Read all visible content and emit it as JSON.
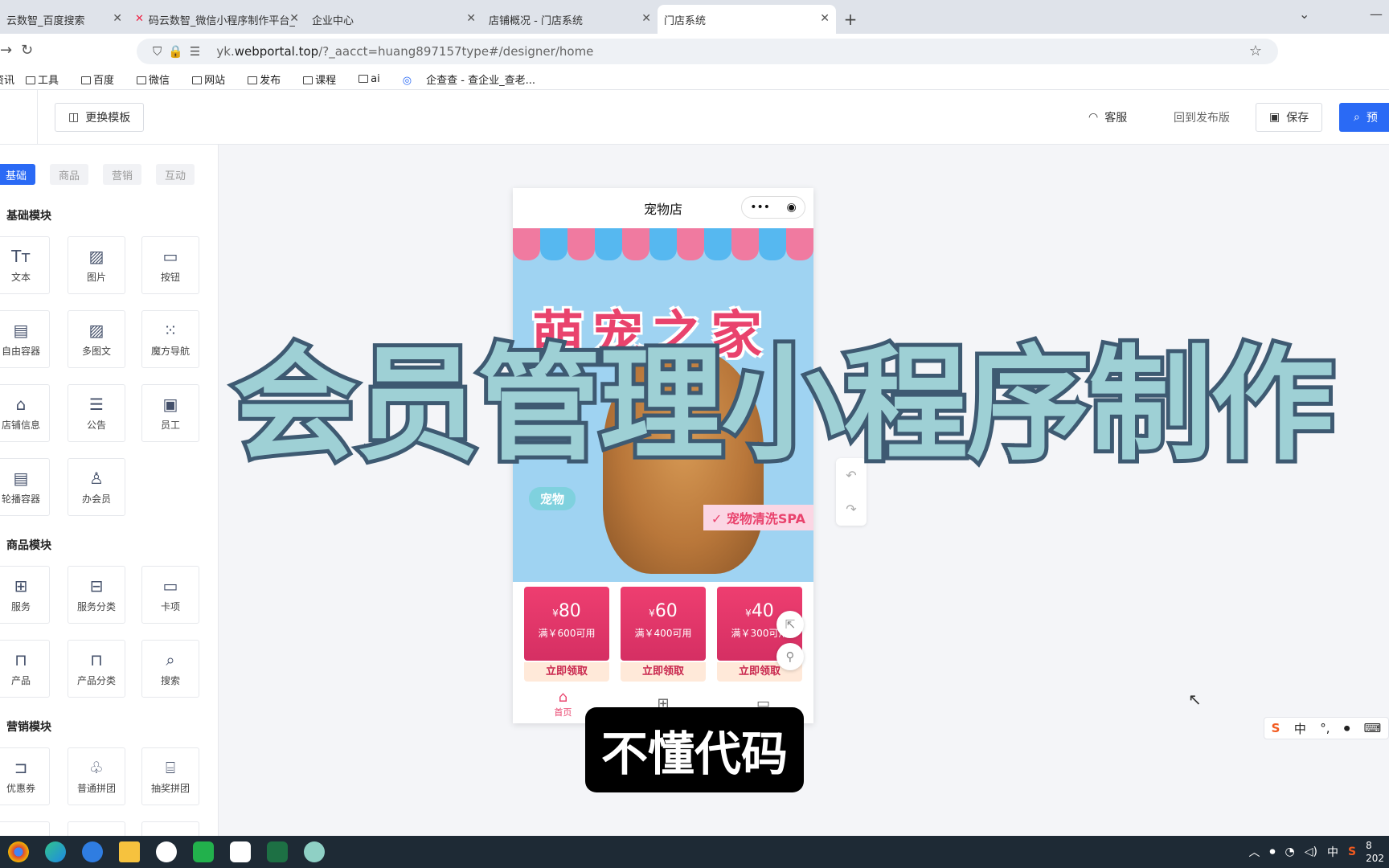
{
  "browser": {
    "tabs": [
      {
        "title": "云数智_百度搜索",
        "active": false
      },
      {
        "title": "码云数智_微信小程序制作平台_",
        "active": false
      },
      {
        "title": "企业中心",
        "active": false
      },
      {
        "title": "店铺概况 - 门店系统",
        "active": false
      },
      {
        "title": "门店系统",
        "active": true
      }
    ],
    "url_prefix": "yk.",
    "url_domain": "webportal.top",
    "url_path": "/?_aacct=huang897157type#/designer/home",
    "bookmarks": [
      "资讯",
      "工具",
      "百度",
      "微信",
      "网站",
      "发布",
      "课程",
      "ai",
      "企查查 - 查企业_查老..."
    ]
  },
  "header": {
    "change_template": "更换模板",
    "service": "客服",
    "back_to_published": "回到发布版",
    "save": "保存",
    "preview": "预"
  },
  "sidebar": {
    "tabs": [
      "基础",
      "商品",
      "营销",
      "互动"
    ],
    "sections": [
      {
        "title": "基础模块",
        "items": [
          {
            "label": "文本",
            "icon": "text-icon"
          },
          {
            "label": "图片",
            "icon": "image-icon"
          },
          {
            "label": "按钮",
            "icon": "button-icon"
          },
          {
            "label": "自由容器",
            "icon": "container-icon"
          },
          {
            "label": "多图文",
            "icon": "multi-image-icon"
          },
          {
            "label": "魔方导航",
            "icon": "grid-nav-icon"
          },
          {
            "label": "店铺信息",
            "icon": "store-icon"
          },
          {
            "label": "公告",
            "icon": "notice-icon"
          },
          {
            "label": "员工",
            "icon": "employee-icon"
          },
          {
            "label": "轮播容器",
            "icon": "carousel-icon"
          },
          {
            "label": "办会员",
            "icon": "member-icon"
          }
        ]
      },
      {
        "title": "商品模块",
        "items": [
          {
            "label": "服务",
            "icon": "service-icon"
          },
          {
            "label": "服务分类",
            "icon": "service-category-icon"
          },
          {
            "label": "卡项",
            "icon": "card-icon"
          },
          {
            "label": "产品",
            "icon": "product-icon"
          },
          {
            "label": "产品分类",
            "icon": "product-category-icon"
          },
          {
            "label": "搜索",
            "icon": "search-icon"
          }
        ]
      },
      {
        "title": "营销模块",
        "items": [
          {
            "label": "优惠券",
            "icon": "coupon-icon"
          },
          {
            "label": "普通拼团",
            "icon": "group-buy-icon"
          },
          {
            "label": "抽奖拼团",
            "icon": "lottery-icon"
          }
        ]
      }
    ]
  },
  "phone": {
    "title": "宠物店",
    "banner_brand": "萌宠之家",
    "tag_left": "宠物",
    "tag_right": "✓ 宠物清洗SPA",
    "coupons": [
      {
        "amount": "80",
        "condition": "满￥600可用",
        "button": "立即领取"
      },
      {
        "amount": "60",
        "condition": "满￥400可用",
        "button": "立即领取"
      },
      {
        "amount": "40",
        "condition": "满￥300可用",
        "button": "立即领取"
      }
    ],
    "nav": [
      {
        "label": "首页",
        "icon": "home-icon"
      },
      {
        "label": "",
        "icon": "category-icon"
      },
      {
        "label": "",
        "icon": "card-icon"
      }
    ]
  },
  "overlay_title": "会员管理小程序制作",
  "subtitle": "不懂代码",
  "ime": {
    "lang": "中"
  },
  "tray": {
    "lang": "中",
    "time": "8",
    "date": "202"
  },
  "colors": {
    "accent": "#2a6af5",
    "pink": "#e9436d",
    "overlay_fill": "#9ed0d5",
    "overlay_stroke": "#3e5a72"
  }
}
